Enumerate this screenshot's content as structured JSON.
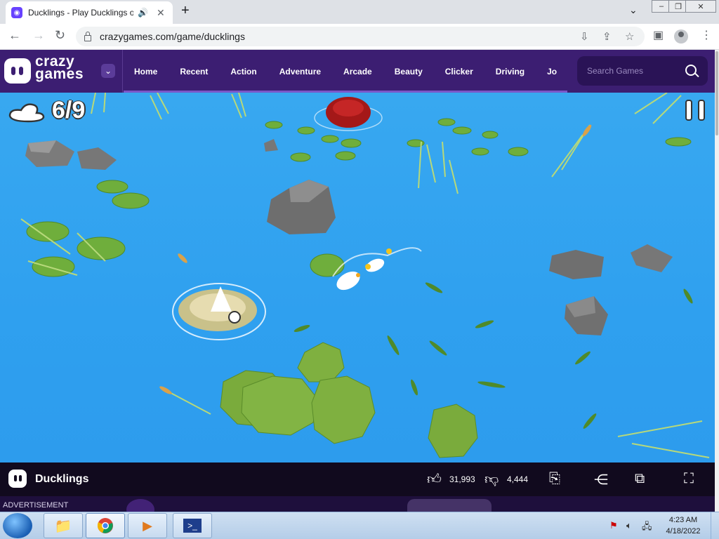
{
  "browser": {
    "tab_title": "Ducklings - Play Ducklings o",
    "tab_audio_icon": "speaker-icon",
    "url": "crazygames.com/game/ducklings"
  },
  "site": {
    "logo_line1": "crazy",
    "logo_line2": "games",
    "nav": [
      "Home",
      "Recent",
      "Action",
      "Adventure",
      "Arcade",
      "Beauty",
      "Clicker",
      "Driving",
      "Jo"
    ],
    "search_placeholder": "Search Games"
  },
  "game": {
    "duckling_count": "6/9",
    "title": "Ducklings",
    "likes": "31,993",
    "dislikes": "4,444"
  },
  "ad_label": "ADVERTISEMENT",
  "taskbar": {
    "time": "4:23 AM",
    "date": "4/18/2022"
  },
  "colors": {
    "site_header": "#3c1e72",
    "water": "#2fa0ef",
    "game_bar": "#110a1e"
  }
}
